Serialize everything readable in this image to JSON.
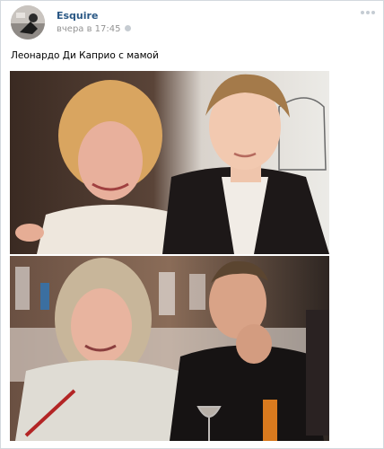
{
  "post": {
    "author": "Esquire",
    "timestamp": "вчера в 17:45",
    "text": "Леонардо Ди Каприо с мамой"
  },
  "icons": {
    "avatar": "esquire-logo-avatar",
    "time": "clock-icon",
    "more": "more-options-icon"
  },
  "colors": {
    "link": "#2a5885",
    "meta": "#939393",
    "border": "#d3d9de"
  }
}
